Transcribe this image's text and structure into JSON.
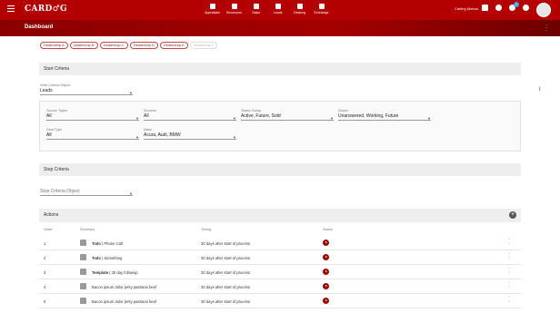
{
  "app": {
    "logo": "CARD♂G",
    "dealer": "Carling Motors",
    "notif_count": "1"
  },
  "nav": [
    {
      "label": "Appraisals",
      "icon": "appraisal-icon"
    },
    {
      "label": "Showroom",
      "icon": "showroom-icon"
    },
    {
      "label": "Tasks",
      "icon": "tasks-icon"
    },
    {
      "label": "Leads",
      "icon": "leads-icon"
    },
    {
      "label": "Desking",
      "icon": "desking-icon"
    },
    {
      "label": "Exchange",
      "icon": "exchange-icon"
    }
  ],
  "header": {
    "title": "Dashboard"
  },
  "dealerships": [
    "Dealership A",
    "Dealership B",
    "Dealership C",
    "Dealership D",
    "Dealership E",
    "Dealership F"
  ],
  "start": {
    "title": "Start Criteria",
    "object_label": "Start Criteria Object",
    "object_value": "Leads",
    "filters": {
      "source_types": {
        "label": "Source Types",
        "value": "All"
      },
      "sources": {
        "label": "Sources",
        "value": "All"
      },
      "status_group": {
        "label": "Status Group",
        "value": "Active, Future, Sold"
      },
      "status": {
        "label": "Status",
        "value": "Unanswered, Working, Future"
      },
      "deal_type": {
        "label": "Deal Type",
        "value": "All"
      },
      "make": {
        "label": "Make",
        "value": "Acura, Audi, BMW"
      }
    }
  },
  "stop": {
    "title": "Stop Criteria",
    "object_placeholder": "Stop Criteria Object"
  },
  "actions": {
    "title": "Actions",
    "headers": {
      "order": "Order",
      "summary": "Summary",
      "timing": "Timing",
      "status": "Status"
    },
    "rows": [
      {
        "order": "1",
        "bold": "Todo",
        "rest": " | Phone Call",
        "timing": "30 days after start of process",
        "icon": "calendar-icon"
      },
      {
        "order": "2",
        "bold": "Todo",
        "rest": " | Something",
        "timing": "30 days after start of process",
        "icon": "calendar-icon"
      },
      {
        "order": "3",
        "bold": "Template",
        "rest": " | 30 day followup",
        "timing": "30 days after start of process",
        "icon": "email-icon"
      },
      {
        "order": "4",
        "bold": "",
        "rest": "Bacon ipsum dolor jerky pastrami beef",
        "timing": "30 days after start of process",
        "icon": "phone-icon"
      },
      {
        "order": "5",
        "bold": "",
        "rest": "Bacon ipsum dolor jerky pastrami beef",
        "timing": "30 days after start of process",
        "icon": "chat-icon"
      }
    ]
  },
  "colors": {
    "brand": "#b30000",
    "status": "#a00000"
  }
}
